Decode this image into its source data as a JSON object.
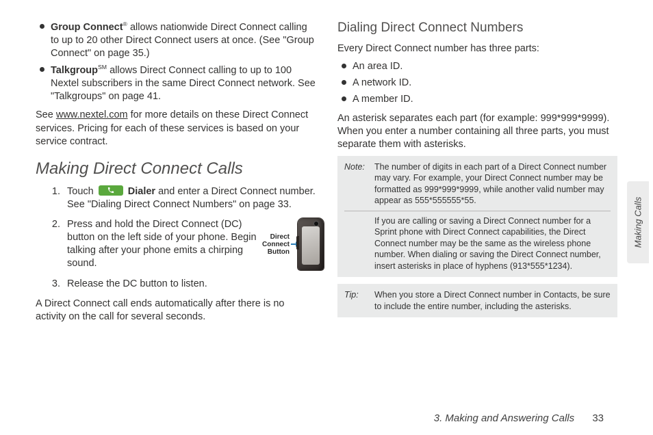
{
  "left": {
    "bullets": [
      {
        "bold": "Group Connect",
        "sup": "®",
        "text": " allows nationwide Direct Connect calling to up to 20 other Direct Connect users at once. (See \"Group Connect\" on page 35.)"
      },
      {
        "bold": "Talkgroup",
        "sup": "SM",
        "text": " allows Direct Connect calling to up to 100 Nextel subscribers in the same Direct Connect network. See \"Talkgroups\" on page 41."
      }
    ],
    "see_pre": "See ",
    "see_link": "www.nextel.com",
    "see_post": " for more details on these Direct Connect services. Pricing for each of these services is based on your service contract.",
    "heading": "Making Direct Connect Calls",
    "steps": {
      "s1_pre": "Touch ",
      "s1_bold": "Dialer",
      "s1_post": " and enter a Direct Connect number. See \"Dialing Direct Connect Numbers\" on page 33.",
      "s2": "Press and hold the Direct Connect (DC) button on the left side of your phone. Begin talking after your phone emits a chirping sound.",
      "s3": "Release the DC button to listen."
    },
    "figure_label_l1": "Direct",
    "figure_label_l2": "Connect",
    "figure_label_l3": "Button",
    "closing": "A Direct Connect call ends automatically after there is no activity on the call for several seconds."
  },
  "right": {
    "sub_heading": "Dialing Direct Connect Numbers",
    "intro": "Every Direct Connect number has three parts:",
    "parts": [
      "An area ID.",
      "A network ID.",
      "A member ID."
    ],
    "asterisk_para": "An asterisk separates each part (for example: 999*999*9999). When you enter a number containing all three parts, you must separate them with asterisks.",
    "note": {
      "label": "Note:",
      "p1": "The number of digits in each part of a Direct Connect number may vary. For example, your Direct Connect number may be formatted as 999*999*9999, while another valid number may appear as 555*555555*55.",
      "p2": "If you are calling or saving a Direct Connect number for a Sprint phone with Direct Connect capabilities, the Direct Connect number may be the same as the wireless phone number. When dialing or saving the Direct Connect number, insert asterisks in place of hyphens (913*555*1234)."
    },
    "tip": {
      "label": "Tip:",
      "p1": "When you store a Direct Connect number in Contacts, be sure to include the entire number, including the asterisks."
    }
  },
  "side_tab": "Making Calls",
  "footer_chapter": "3. Making and Answering Calls",
  "footer_page": "33"
}
